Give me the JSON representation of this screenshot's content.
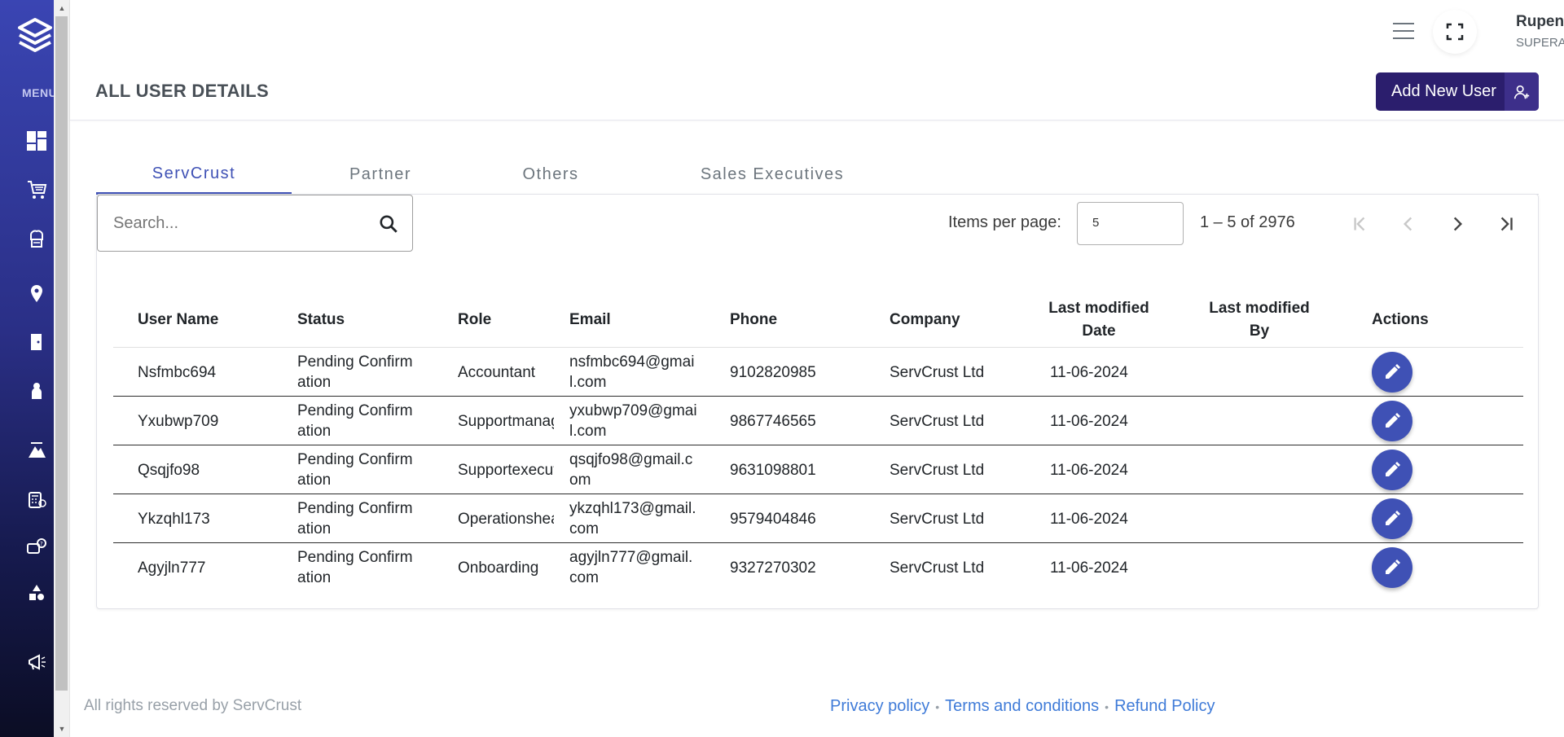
{
  "sidebar": {
    "menu_label": "MENU",
    "items": [
      {
        "icon": "dashboard-icon"
      },
      {
        "icon": "cart-icon"
      },
      {
        "icon": "chef-icon"
      },
      {
        "icon": "location-icon"
      },
      {
        "icon": "door-icon"
      },
      {
        "icon": "person-icon"
      },
      {
        "icon": "lifting-icon"
      },
      {
        "icon": "calculator-icon"
      },
      {
        "icon": "support-chat-icon"
      },
      {
        "icon": "shapes-icon"
      },
      {
        "icon": "megaphone-icon"
      }
    ]
  },
  "header": {
    "user_name": "Rupendhra",
    "user_role": "SUPERADMIN",
    "page_title": "ALL USER DETAILS",
    "add_button_label": "Add New User"
  },
  "tabs": [
    {
      "label": "ServCrust",
      "active": true
    },
    {
      "label": "Partner",
      "active": false
    },
    {
      "label": "Others",
      "active": false
    },
    {
      "label": "Sales Executives",
      "active": false
    }
  ],
  "toolbar": {
    "search_placeholder": "Search...",
    "items_per_page_label": "Items per page:",
    "items_per_page_value": "5",
    "range_label": "1 – 5 of 2976"
  },
  "table": {
    "columns": {
      "user_name": "User Name",
      "status": "Status",
      "role": "Role",
      "email": "Email",
      "phone": "Phone",
      "company": "Company",
      "last_modified_date": "Last modified Date",
      "last_modified_by": "Last modified By",
      "actions": "Actions"
    },
    "rows": [
      {
        "user_name": "Nsfmbc694",
        "status": "Pending Confirmation",
        "role": "Accountant",
        "email": "nsfmbc694@gmail.com",
        "phone": "9102820985",
        "company": "ServCrust Ltd",
        "date": "11-06-2024",
        "by": ""
      },
      {
        "user_name": "Yxubwp709",
        "status": "Pending Confirmation",
        "role": "Supportmanager",
        "email": "yxubwp709@gmail.com",
        "phone": "9867746565",
        "company": "ServCrust Ltd",
        "date": "11-06-2024",
        "by": ""
      },
      {
        "user_name": "Qsqjfo98",
        "status": "Pending Confirmation",
        "role": "Supportexecutive",
        "email": "qsqjfo98@gmail.com",
        "phone": "9631098801",
        "company": "ServCrust Ltd",
        "date": "11-06-2024",
        "by": ""
      },
      {
        "user_name": "Ykzqhl173",
        "status": "Pending Confirmation",
        "role": "Operationshead",
        "email": "ykzqhl173@gmail.com",
        "phone": "9579404846",
        "company": "ServCrust Ltd",
        "date": "11-06-2024",
        "by": ""
      },
      {
        "user_name": "Agyjln777",
        "status": "Pending Confirmation",
        "role": "Onboarding",
        "email": "agyjln777@gmail.com",
        "phone": "9327270302",
        "company": "ServCrust Ltd",
        "date": "11-06-2024",
        "by": ""
      }
    ]
  },
  "footer": {
    "copyright": "All rights reserved by ServCrust",
    "links": [
      "Privacy policy",
      "Terms and conditions",
      "Refund Policy"
    ]
  },
  "colors": {
    "primary": "#3f51b5",
    "brand_dark": "#2b1e6d",
    "link": "#3f7bd8"
  }
}
